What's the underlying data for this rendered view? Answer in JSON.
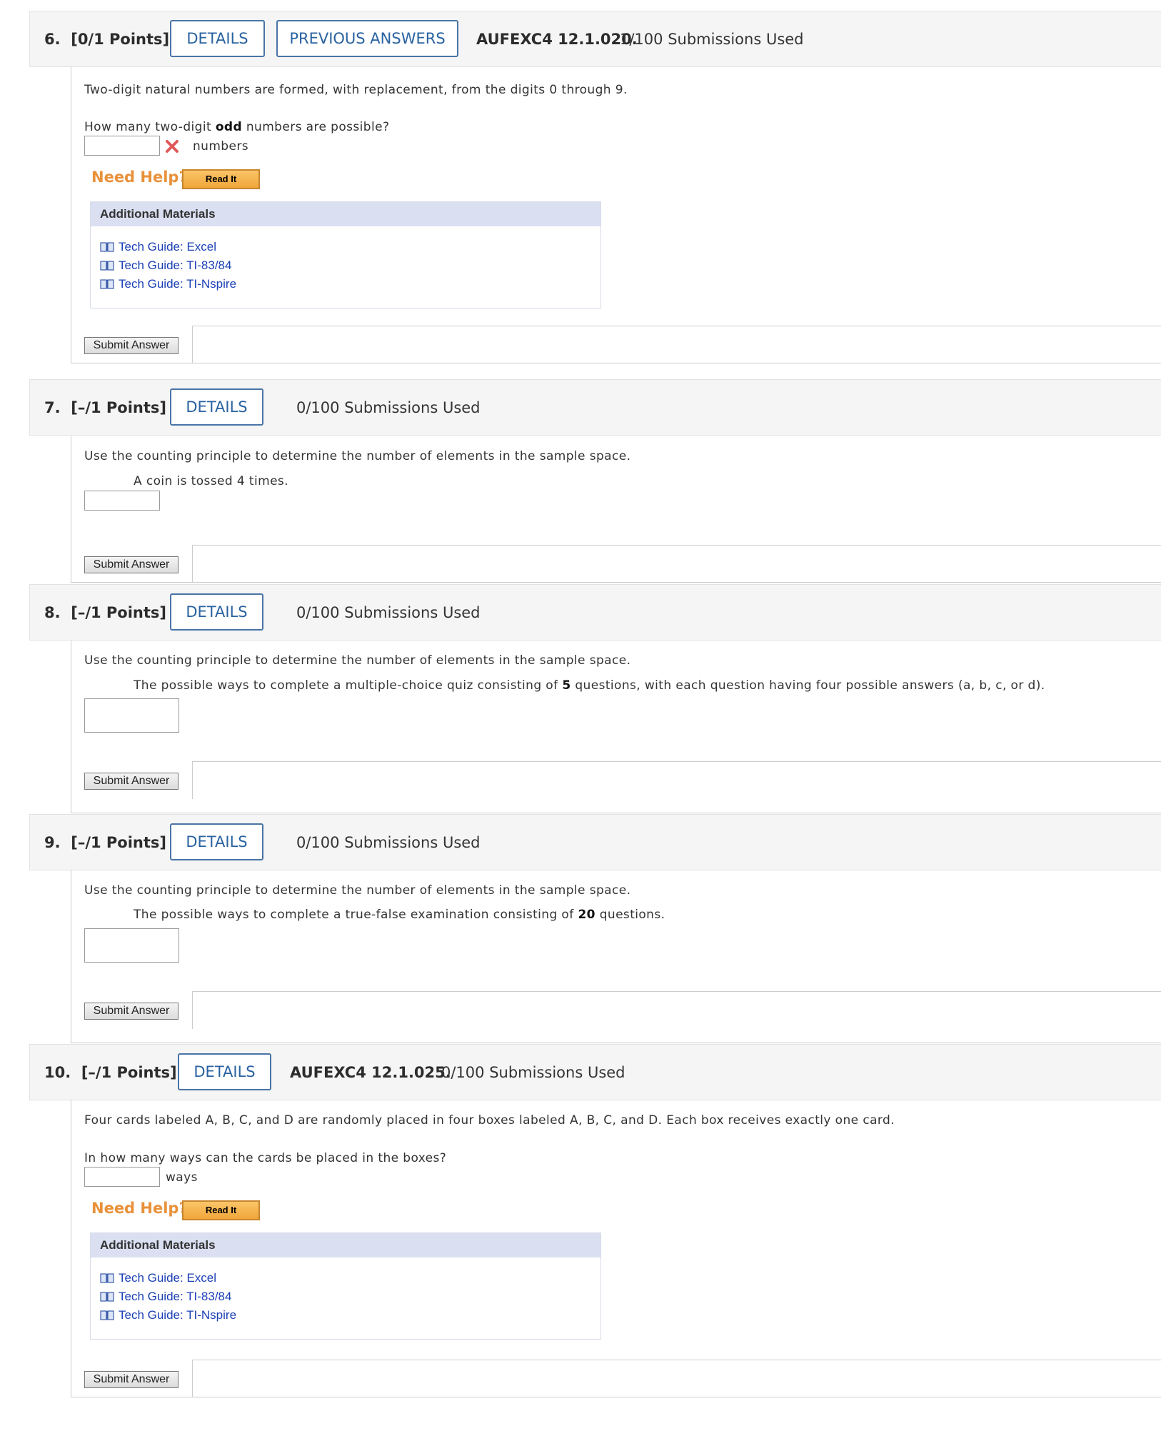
{
  "questions": [
    {
      "number": "6.",
      "points": "[0/1 Points]",
      "details_label": "DETAILS",
      "previous_answers_label": "PREVIOUS ANSWERS",
      "code": "AUFEXC4 12.1.020.",
      "submissions": "1/100 Submissions Used",
      "text1": "Two-digit natural numbers are formed, with replacement, from the digits 0 through 9.",
      "text2_pre": "How many two-digit ",
      "text2_bold": "odd",
      "text2_post": " numbers are possible?",
      "answer_value": "",
      "answer_status": "incorrect",
      "units": "numbers",
      "need_help": "Need Help?",
      "read_it": "Read It",
      "materials_title": "Additional Materials",
      "materials": [
        "Tech Guide: Excel",
        "Tech Guide: TI-83/84",
        "Tech Guide: TI-Nspire"
      ],
      "submit_label": "Submit Answer"
    },
    {
      "number": "7.",
      "points": "[–/1 Points]",
      "details_label": "DETAILS",
      "submissions": "0/100 Submissions Used",
      "text1": "Use the counting principle to determine the number of elements in the sample space.",
      "text2": "A coin is tossed 4 times.",
      "answer_value": "",
      "submit_label": "Submit Answer"
    },
    {
      "number": "8.",
      "points": "[–/1 Points]",
      "details_label": "DETAILS",
      "submissions": "0/100 Submissions Used",
      "text1": "Use the counting principle to determine the number of elements in the sample space.",
      "text2_pre": "The possible ways to complete a multiple-choice quiz consisting of ",
      "text2_bold": "5",
      "text2_post": " questions, with each question having four possible answers (a, b, c, or d).",
      "answer_value": "",
      "submit_label": "Submit Answer"
    },
    {
      "number": "9.",
      "points": "[–/1 Points]",
      "details_label": "DETAILS",
      "submissions": "0/100 Submissions Used",
      "text1": "Use the counting principle to determine the number of elements in the sample space.",
      "text2_pre": "The possible ways to complete a true-false examination consisting of ",
      "text2_bold": "20",
      "text2_post": " questions.",
      "answer_value": "",
      "submit_label": "Submit Answer"
    },
    {
      "number": "10.",
      "points": "[–/1 Points]",
      "details_label": "DETAILS",
      "code": "AUFEXC4 12.1.025.",
      "submissions": "0/100 Submissions Used",
      "text1": "Four cards labeled A, B, C, and D are randomly placed in four boxes labeled A, B, C, and D. Each box receives exactly one card.",
      "text2": "In how many ways can the cards be placed in the boxes?",
      "answer_value": "",
      "units": "ways",
      "need_help": "Need Help?",
      "read_it": "Read It",
      "materials_title": "Additional Materials",
      "materials": [
        "Tech Guide: Excel",
        "Tech Guide: TI-83/84",
        "Tech Guide: TI-Nspire"
      ],
      "submit_label": "Submit Answer"
    }
  ],
  "colors": {
    "accent_blue": "#2a62a0",
    "need_help_orange": "#e8913a",
    "link_blue": "#1a3fb5",
    "incorrect_red": "#e05a5a",
    "materials_header": "#dadff2"
  },
  "icons": {
    "incorrect": "x-mark-icon",
    "material": "book-icon"
  }
}
